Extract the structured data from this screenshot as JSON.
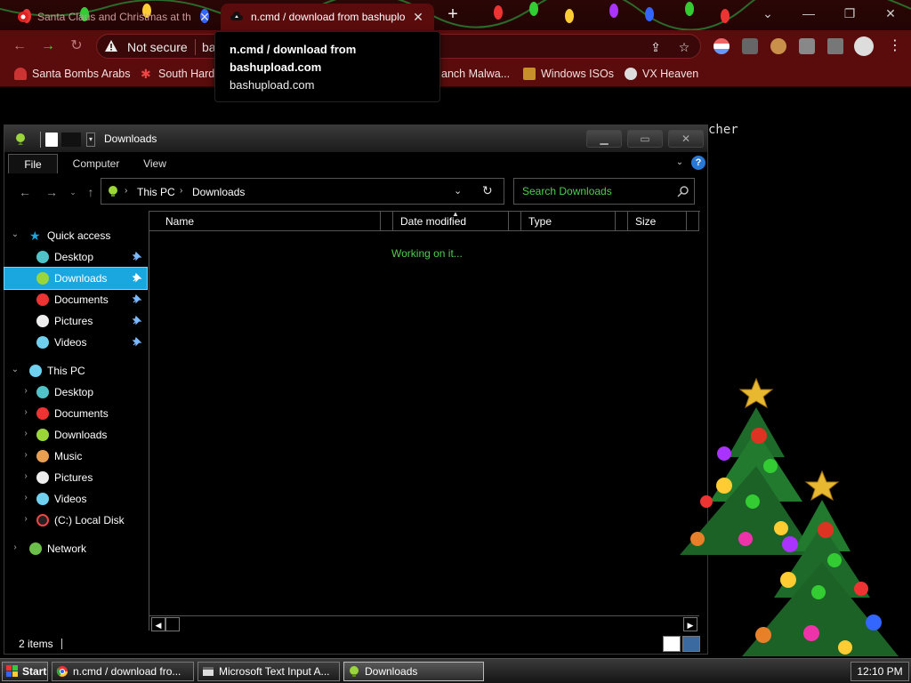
{
  "browser": {
    "tabs": [
      {
        "title": "Santa Claus and Christmas at th",
        "active": false
      },
      {
        "title": "n.cmd / download from bashuplo",
        "active": true
      }
    ],
    "security_label": "Not secure",
    "url_fragment": "ba",
    "bookmarks": [
      "Santa Bombs Arabs",
      "South Hard",
      "anch Malwa...",
      "Windows ISOs",
      "VX Heaven"
    ],
    "tooltip": {
      "title": "n.cmd / download from bashupload.com",
      "host": "bashupload.com"
    },
    "page_text_fragment": "cher"
  },
  "explorer": {
    "title": "Downloads",
    "ribbon_tabs": [
      "File",
      "Computer",
      "View"
    ],
    "help_label": "?",
    "breadcrumb": [
      "This PC",
      "Downloads"
    ],
    "search_placeholder": "Search Downloads",
    "quick_access_label": "Quick access",
    "quick_access": [
      "Desktop",
      "Downloads",
      "Documents",
      "Pictures",
      "Videos"
    ],
    "this_pc_label": "This PC",
    "this_pc": [
      "Desktop",
      "Documents",
      "Downloads",
      "Music",
      "Pictures",
      "Videos",
      "(C:) Local Disk"
    ],
    "network_label": "Network",
    "columns": [
      "Name",
      "Date modified",
      "Type",
      "Size"
    ],
    "loading_text": "Working on it...",
    "item_count": "2 items"
  },
  "taskbar": {
    "start_label": "Start",
    "tasks": [
      "n.cmd / download fro...",
      "Microsoft Text Input A...",
      "Downloads"
    ],
    "clock": "12:10 PM"
  },
  "colors": {
    "browser_frame": "#5a0c0c",
    "selection": "#1aa7e0",
    "accent_green": "#4fcf4f",
    "help_blue": "#2a78d6"
  }
}
